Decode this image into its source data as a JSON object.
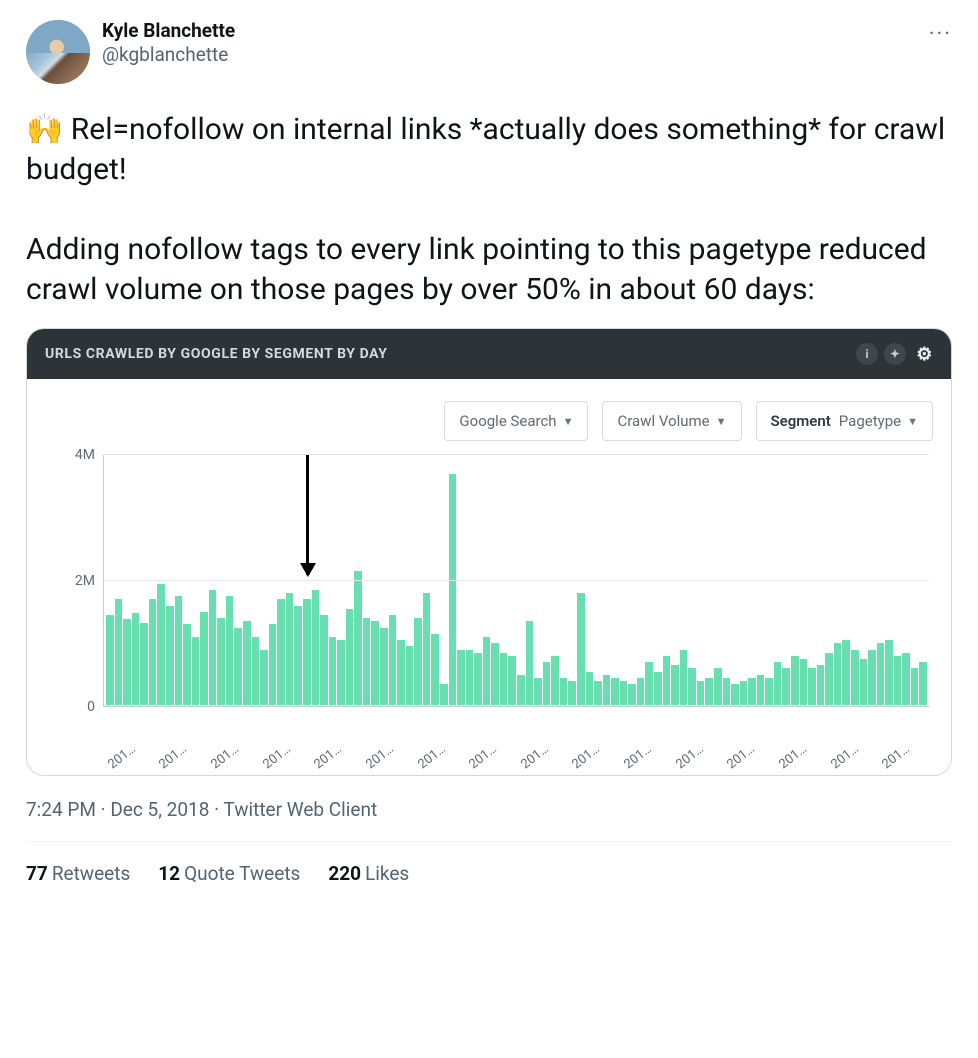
{
  "author": {
    "display_name": "Kyle Blanchette",
    "handle": "@kgblanchette"
  },
  "more_label": "···",
  "text": "🙌 Rel=nofollow on internal links *actually does something* for crawl budget!\n\nAdding nofollow tags to every link pointing to this pagetype reduced crawl volume on those pages by over 50% in about 60 days:",
  "card": {
    "title": "URLS CRAWLED BY GOOGLE BY SEGMENT BY DAY",
    "filters": {
      "search": "Google Search",
      "metric": "Crawl Volume",
      "segment_label": "Segment",
      "segment_value": "Pagetype"
    }
  },
  "chart_data": {
    "type": "bar",
    "ylabel": "",
    "xlabel": "",
    "yticks": [
      0,
      2000000,
      4000000
    ],
    "ytick_labels": [
      "0",
      "2M",
      "4M"
    ],
    "ylim": [
      0,
      4000000
    ],
    "x_tick_label": "201…",
    "x_tick_count": 16,
    "arrow_index": 23,
    "values": [
      1450000,
      1700000,
      1380000,
      1480000,
      1320000,
      1700000,
      1950000,
      1600000,
      1750000,
      1300000,
      1100000,
      1500000,
      1850000,
      1400000,
      1750000,
      1250000,
      1350000,
      1100000,
      900000,
      1300000,
      1700000,
      1800000,
      1600000,
      1700000,
      1850000,
      1450000,
      1100000,
      1050000,
      1550000,
      2150000,
      1400000,
      1350000,
      1250000,
      1450000,
      1050000,
      950000,
      1400000,
      1800000,
      1150000,
      350000,
      3700000,
      900000,
      900000,
      850000,
      1100000,
      1000000,
      850000,
      800000,
      500000,
      1350000,
      450000,
      700000,
      800000,
      450000,
      400000,
      1800000,
      550000,
      400000,
      500000,
      450000,
      400000,
      350000,
      450000,
      700000,
      550000,
      800000,
      650000,
      900000,
      600000,
      400000,
      450000,
      600000,
      450000,
      350000,
      400000,
      450000,
      500000,
      450000,
      700000,
      600000,
      800000,
      750000,
      600000,
      650000,
      850000,
      1000000,
      1050000,
      900000,
      750000,
      900000,
      1000000,
      1050000,
      800000,
      850000,
      600000,
      700000
    ]
  },
  "meta": {
    "time": "7:24 PM",
    "sep": " · ",
    "date": "Dec 5, 2018",
    "source": "Twitter Web Client"
  },
  "stats": {
    "retweets_count": "77",
    "retweets_label": "Retweets",
    "quotes_count": "12",
    "quotes_label": "Quote Tweets",
    "likes_count": "220",
    "likes_label": "Likes"
  }
}
